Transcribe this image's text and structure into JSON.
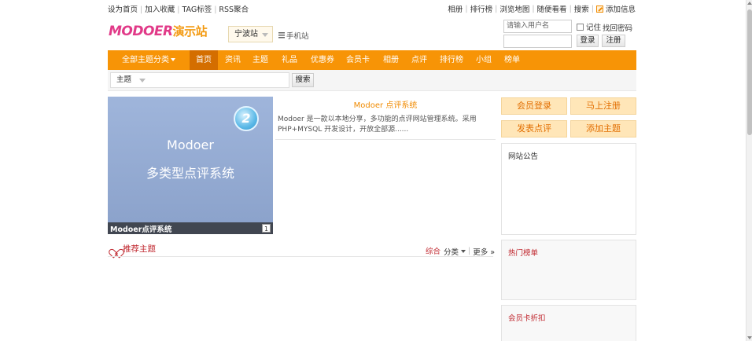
{
  "top_links": {
    "left": [
      "设为首页",
      "加入收藏",
      "TAG标签",
      "RSS聚合"
    ],
    "right": [
      "相册",
      "排行榜",
      "浏览地图",
      "随便看看",
      "搜索"
    ],
    "add_info": "添加信息"
  },
  "header": {
    "logo_main": "MODOER",
    "logo_sub": "演示站",
    "city": "宁波站",
    "mobile": "手机站"
  },
  "login": {
    "username_placeholder": "请输入用户名",
    "remember": "记住",
    "forgot": "找回密码",
    "login_btn": "登录",
    "register_btn": "注册"
  },
  "nav": {
    "all": "全部主题分类",
    "items": [
      "首页",
      "资讯",
      "主题",
      "礼品",
      "优惠券",
      "会员卡",
      "相册",
      "点评",
      "排行榜",
      "小组",
      "榜单"
    ],
    "active": "首页"
  },
  "search": {
    "type": "主题",
    "button": "搜索"
  },
  "slide": {
    "line1": "Modoer",
    "line2": "多类型点评系统",
    "badge": "2",
    "caption": "Modoer点评系统",
    "index": "1"
  },
  "article": {
    "title": "Modoer 点评系统",
    "desc": "Modoer 是一款以本地分享，多功能的点评网站管理系统。采用 PHP+MYSQL 开发设计，开放全部源......"
  },
  "recommend": {
    "title": "推荐主题",
    "tab_all": "综合",
    "tab_cat": "分类",
    "more": "更多 »"
  },
  "sidebar": {
    "buttons": [
      "会员登录",
      "马上注册",
      "发表点评",
      "添加主题"
    ],
    "notice": "网站公告",
    "hot": "热门榜单",
    "card": "会员卡折扣"
  },
  "colors": {
    "nav": "#f79406",
    "nav_active": "#d46e00",
    "accent": "#f08a00",
    "red": "#c0282f"
  }
}
